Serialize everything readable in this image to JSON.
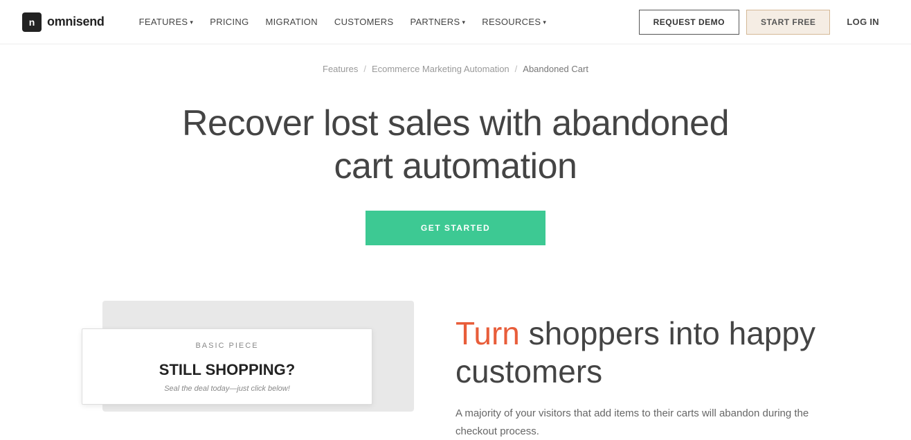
{
  "brand": {
    "icon_text": "n",
    "name": "omnisend"
  },
  "navbar": {
    "links": [
      {
        "label": "FEATURES",
        "has_dropdown": true
      },
      {
        "label": "PRICING",
        "has_dropdown": false
      },
      {
        "label": "MIGRATION",
        "has_dropdown": false
      },
      {
        "label": "CUSTOMERS",
        "has_dropdown": false
      },
      {
        "label": "PARTNERS",
        "has_dropdown": true
      },
      {
        "label": "RESOURCES",
        "has_dropdown": true
      }
    ],
    "request_demo": "REQUEST DEMO",
    "start_free": "START FREE",
    "log_in": "LOG IN"
  },
  "breadcrumb": {
    "items": [
      {
        "label": "Features",
        "href": "#"
      },
      {
        "label": "Ecommerce Marketing Automation",
        "href": "#"
      },
      {
        "label": "Abandoned Cart",
        "current": true
      }
    ]
  },
  "hero": {
    "title": "Recover lost sales with abandoned cart automation",
    "cta_label": "GET STARTED"
  },
  "email_card": {
    "brand": "BASIC PIECE",
    "headline": "STILL SHOPPING?",
    "subtext": "Seal the deal today—just click below!"
  },
  "lower": {
    "heading_highlight": "Turn",
    "heading_rest": " shoppers into happy customers",
    "body_text": "A majority of your visitors that add items to their carts will abandon during the checkout process."
  }
}
